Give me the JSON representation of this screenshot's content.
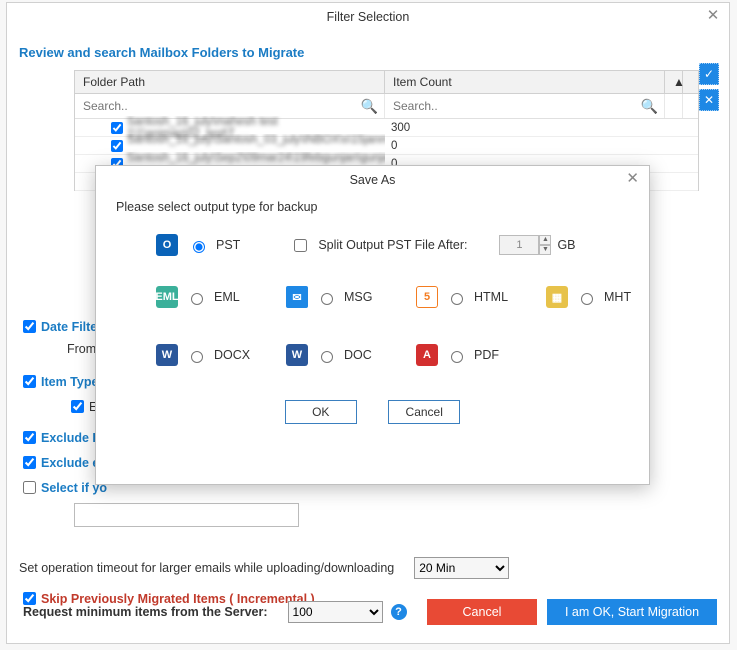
{
  "window": {
    "title": "Filter Selection"
  },
  "heading": "Review and search Mailbox Folders to Migrate",
  "grid": {
    "col1": "Folder Path",
    "col2": "Item Count",
    "search_ph": "Search..",
    "rows": [
      {
        "path": "Santosh_16_july\\mahesh test 1\\1\\animap\\02_test\\T . .",
        "count": "300"
      },
      {
        "path": "Santosh_16_july\\Santosh_03_july\\INBOX\\s\\15janma . .",
        "count": "0"
      },
      {
        "path": "Santosh_16_july\\Sep2\\09mar24\\19febgunjan\\gunjan . .",
        "count": "0"
      },
      {
        "path": " ",
        "count": " "
      }
    ]
  },
  "filters": {
    "date": "Date Filter",
    "from": "From",
    "item": "Item Type",
    "e": "E",
    "excl_d": "Exclude De",
    "excl_e": "Exclude em",
    "select_if": "Select if yo",
    "timeout_label": "Set operation timeout for larger emails while uploading/downloading",
    "timeout_val": "20 Min",
    "skip": "Skip Previously Migrated Items ( Incremental )",
    "req_label": "Request minimum items from the Server:",
    "req_val": "100"
  },
  "buttons": {
    "cancel": "Cancel",
    "start": "I am OK, Start Migration"
  },
  "modal": {
    "title": "Save As",
    "prompt": "Please select output type for backup",
    "pst": "PST",
    "split_label": "Split Output PST File After:",
    "split_val": "1",
    "gb": "GB",
    "eml": "EML",
    "msg": "MSG",
    "html": "HTML",
    "mht": "MHT",
    "docx": "DOCX",
    "doc": "DOC",
    "pdf": "PDF",
    "ok": "OK",
    "cancel": "Cancel"
  }
}
